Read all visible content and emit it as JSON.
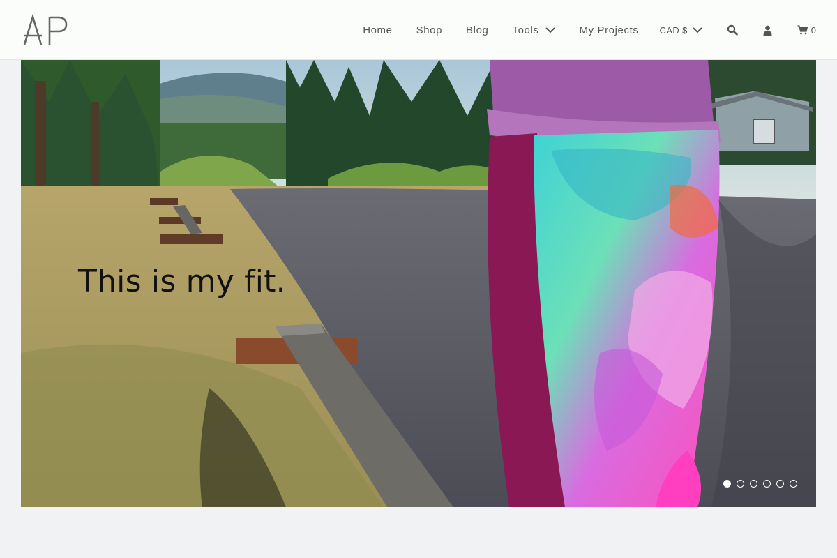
{
  "brand": {
    "logo_text": "AP"
  },
  "nav": {
    "items": [
      {
        "label": "Home"
      },
      {
        "label": "Shop"
      },
      {
        "label": "Blog"
      },
      {
        "label": "Tools"
      },
      {
        "label": "My Projects"
      }
    ],
    "currency": "CAD $",
    "cart_count": "0",
    "icons": [
      "search-icon",
      "user-icon",
      "cart-icon"
    ]
  },
  "hero": {
    "caption": "This is my fit.",
    "slide_count": 6,
    "active_slide": 1
  },
  "colors": {
    "header_bg": "#fbfdfb",
    "page_bg": "#f1f2f4",
    "text": "#555555"
  }
}
